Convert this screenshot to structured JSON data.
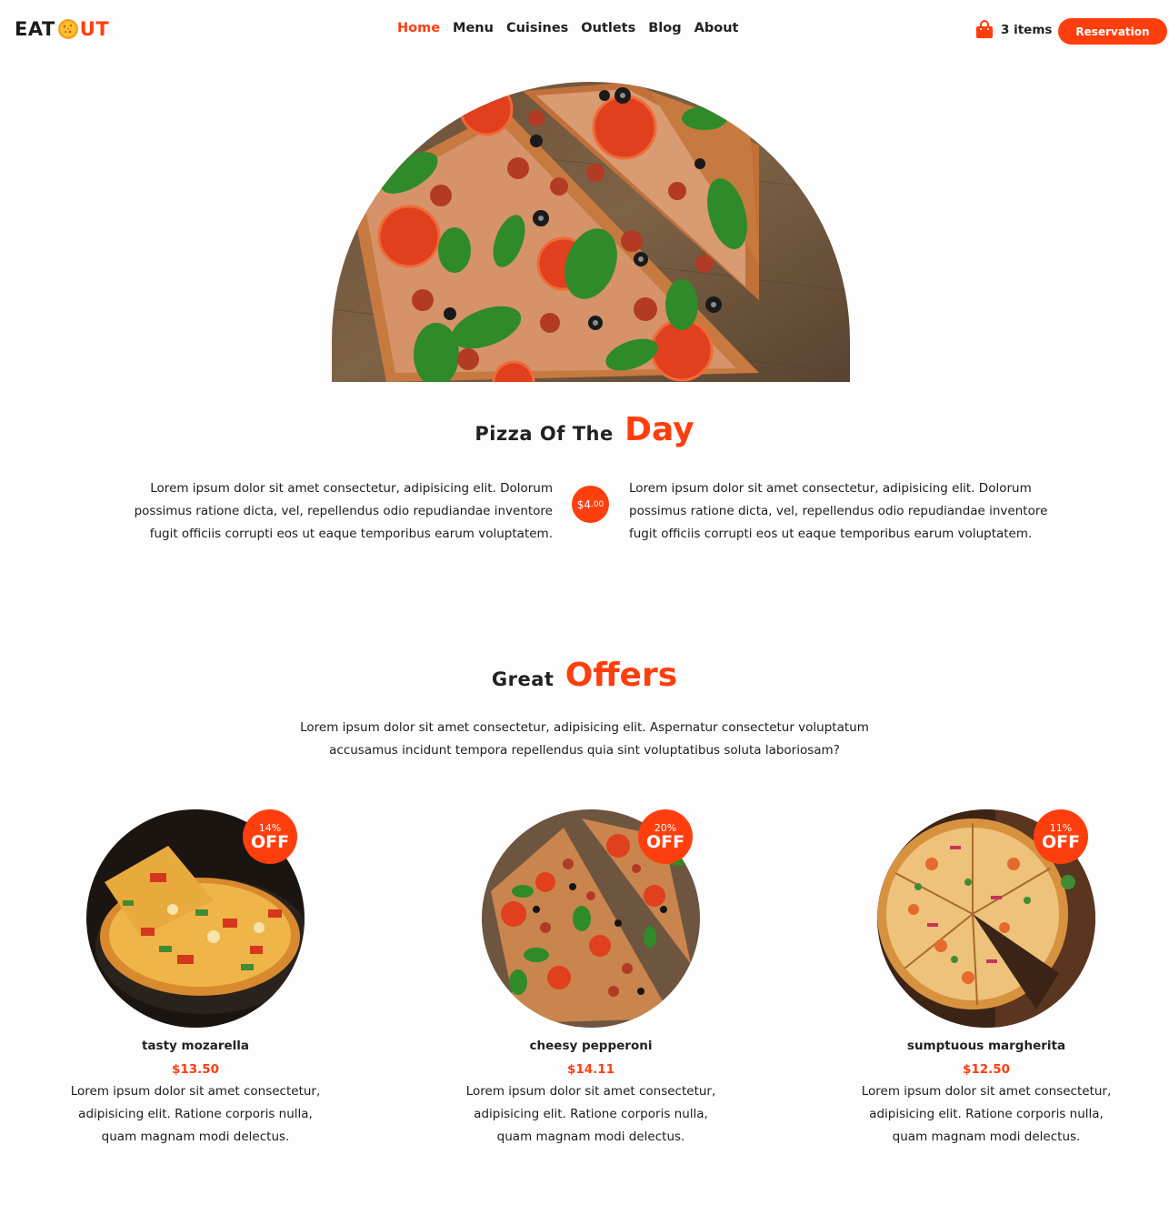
{
  "brand": {
    "part1": "EAT",
    "part2": "UT"
  },
  "nav": [
    {
      "label": "Home",
      "active": true
    },
    {
      "label": "Menu"
    },
    {
      "label": "Cuisines"
    },
    {
      "label": "Outlets"
    },
    {
      "label": "Blog"
    },
    {
      "label": "About"
    }
  ],
  "cart": {
    "icon": "shopping-bag-icon",
    "count_label": "3 items"
  },
  "reservation_label": "Reservation",
  "pizza_of_day": {
    "title_small": "Pizza Of The",
    "title_big": "Day",
    "text_left": "Lorem ipsum dolor sit amet consectetur, adipisicing elit. Dolorum possimus ratione dicta, vel, repellendus odio repudiandae inventore fugit officiis corrupti eos ut eaque temporibus earum voluptatem.",
    "text_right": "Lorem ipsum dolor sit amet consectetur, adipisicing elit. Dolorum possimus ratione dicta, vel, repellendus odio repudiandae inventore fugit officiis corrupti eos ut eaque temporibus earum voluptatem.",
    "price_main": "$4",
    "price_cents": ".00"
  },
  "offers": {
    "title_small": "Great",
    "title_big": "Offers",
    "description": "Lorem ipsum dolor sit amet consectetur, adipisicing elit. Aspernatur consectetur voluptatum accusamus incidunt tempora repellendus quia sint voluptatibus soluta laboriosam?",
    "items": [
      {
        "name": "tasty mozarella",
        "price": "$13.50",
        "discount": "14%",
        "off": "OFF",
        "desc": "Lorem ipsum dolor sit amet consectetur, adipisicing elit. Ratione corporis nulla, quam magnam modi delectus."
      },
      {
        "name": "cheesy pepperoni",
        "price": "$14.11",
        "discount": "20%",
        "off": "OFF",
        "desc": "Lorem ipsum dolor sit amet consectetur, adipisicing elit. Ratione corporis nulla, quam magnam modi delectus."
      },
      {
        "name": "sumptuous margherita",
        "price": "$12.50",
        "discount": "11%",
        "off": "OFF",
        "desc": "Lorem ipsum dolor sit amet consectetur, adipisicing elit. Ratione corporis nulla, quam magnam modi delectus."
      }
    ]
  },
  "colors": {
    "accent": "#ff3e0e",
    "text": "#222222",
    "background": "#fefdfe"
  }
}
